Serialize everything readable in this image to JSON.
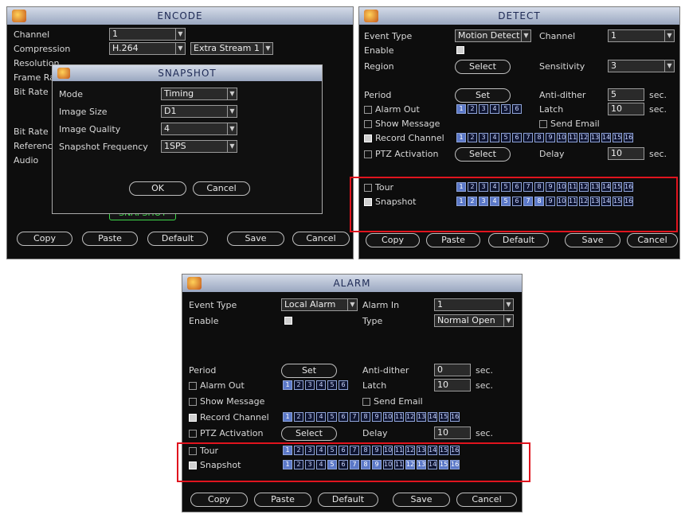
{
  "encode": {
    "title": "ENCODE",
    "labels": [
      "Channel",
      "Compression",
      "Resolution",
      "Frame Rate",
      "Bit Rate",
      "Bit Rate",
      "Reference",
      "Audio"
    ],
    "channel_value": "1",
    "compression_value": "H.264",
    "stream_value": "Extra Stream 1",
    "snapshot_button": "SNAPSHOT",
    "buttons": {
      "copy": "Copy",
      "paste": "Paste",
      "default": "Default",
      "save": "Save",
      "cancel": "Cancel"
    }
  },
  "snapshot_dialog": {
    "title": "SNAPSHOT",
    "mode_label": "Mode",
    "mode_value": "Timing",
    "size_label": "Image Size",
    "size_value": "D1",
    "quality_label": "Image Quality",
    "quality_value": "4",
    "freq_label": "Snapshot Frequency",
    "freq_value": "1SPS",
    "ok": "OK",
    "cancel": "Cancel"
  },
  "detect": {
    "title": "DETECT",
    "event_type_label": "Event Type",
    "event_type_value": "Motion Detect",
    "channel_label": "Channel",
    "channel_value": "1",
    "enable_label": "Enable",
    "region_label": "Region",
    "region_button": "Select",
    "sensitivity_label": "Sensitivity",
    "sensitivity_value": "3",
    "period_label": "Period",
    "period_button": "Set",
    "anti_dither_label": "Anti-dither",
    "anti_dither_value": "5",
    "anti_dither_unit": "sec.",
    "alarm_out_label": "Alarm Out",
    "latch_label": "Latch",
    "latch_value": "10",
    "latch_unit": "sec.",
    "show_message_label": "Show Message",
    "send_email_label": "Send Email",
    "record_channel_label": "Record Channel",
    "ptz_label": "PTZ Activation",
    "ptz_button": "Select",
    "delay_label": "Delay",
    "delay_value": "10",
    "delay_unit": "sec.",
    "tour_label": "Tour",
    "snapshot_label": "Snapshot",
    "buttons": {
      "copy": "Copy",
      "paste": "Paste",
      "default": "Default",
      "save": "Save",
      "cancel": "Cancel"
    }
  },
  "alarm": {
    "title": "ALARM",
    "event_type_label": "Event Type",
    "event_type_value": "Local Alarm",
    "alarm_in_label": "Alarm In",
    "alarm_in_value": "1",
    "enable_label": "Enable",
    "type_label": "Type",
    "type_value": "Normal Open",
    "period_label": "Period",
    "period_button": "Set",
    "anti_dither_label": "Anti-dither",
    "anti_dither_value": "0",
    "anti_dither_unit": "sec.",
    "alarm_out_label": "Alarm Out",
    "latch_label": "Latch",
    "latch_value": "10",
    "latch_unit": "sec.",
    "show_message_label": "Show Message",
    "send_email_label": "Send Email",
    "record_channel_label": "Record Channel",
    "ptz_label": "PTZ Activation",
    "ptz_button": "Select",
    "delay_label": "Delay",
    "delay_value": "10",
    "delay_unit": "sec.",
    "tour_label": "Tour",
    "snapshot_label": "Snapshot",
    "buttons": {
      "copy": "Copy",
      "paste": "Paste",
      "default": "Default",
      "save": "Save",
      "cancel": "Cancel"
    }
  },
  "channels": [
    "1",
    "2",
    "3",
    "4",
    "5",
    "6",
    "7",
    "8",
    "9",
    "10",
    "11",
    "12",
    "13",
    "14",
    "15",
    "16"
  ],
  "colors": {
    "highlight": "#e0141e",
    "title_bar": "#9aa7c0",
    "panel_bg": "#0d0d0d",
    "channel_on": "#5b78c8"
  }
}
